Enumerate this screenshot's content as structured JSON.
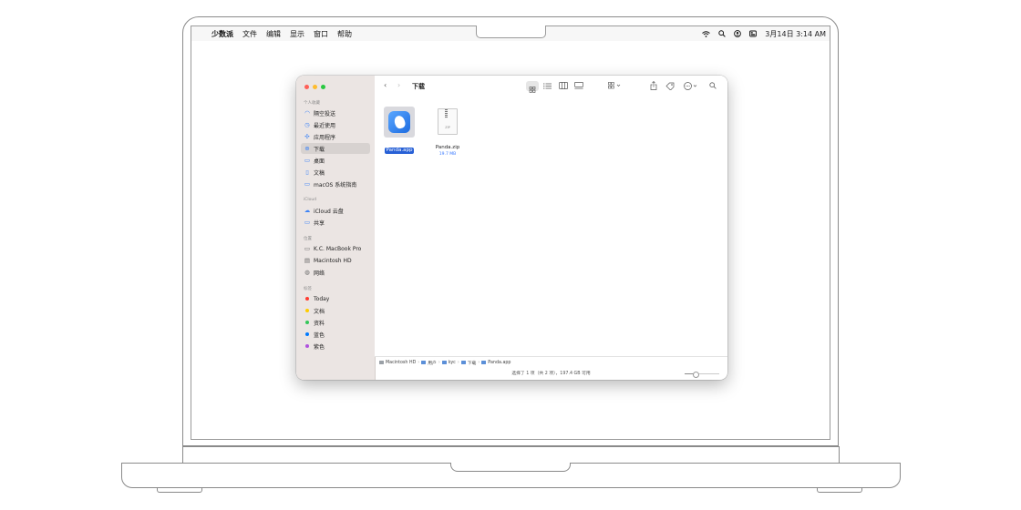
{
  "menubar": {
    "apple_glyph": "",
    "app_name": "少数派",
    "menus": [
      "文件",
      "编辑",
      "显示",
      "窗口",
      "帮助"
    ],
    "datetime": "3月14日  3:14 AM",
    "icons": [
      "wifi-icon",
      "search-icon",
      "user-icon",
      "control-center-icon"
    ]
  },
  "window": {
    "title": "下载",
    "colors": {
      "close": "#ff5f57",
      "minimize": "#febc2e",
      "zoom": "#28c840",
      "selection": "#2760d6"
    },
    "sidebar": {
      "sections": [
        {
          "heading": "个人收藏",
          "items": [
            {
              "label": "隔空投送",
              "icon": "airdrop-icon"
            },
            {
              "label": "最近使用",
              "icon": "clock-icon"
            },
            {
              "label": "应用程序",
              "icon": "apps-icon"
            },
            {
              "label": "下载",
              "icon": "download-icon",
              "selected": true
            },
            {
              "label": "桌面",
              "icon": "desktop-icon"
            },
            {
              "label": "文稿",
              "icon": "document-icon"
            },
            {
              "label": "macOS 系统指南",
              "icon": "folder-icon"
            }
          ]
        },
        {
          "heading": "iCloud",
          "items": [
            {
              "label": "iCloud 云盘",
              "icon": "cloud-icon"
            },
            {
              "label": "共享",
              "icon": "shared-folder-icon"
            }
          ]
        },
        {
          "heading": "位置",
          "items": [
            {
              "label": "K.C. MacBook Pro",
              "icon": "laptop-icon"
            },
            {
              "label": "Macintosh HD",
              "icon": "disk-icon"
            },
            {
              "label": "网络",
              "icon": "globe-icon"
            }
          ]
        },
        {
          "heading": "标签",
          "items": [
            {
              "label": "Today",
              "color": "#ff3b30"
            },
            {
              "label": "文档",
              "color": "#ffcc00"
            },
            {
              "label": "资料",
              "color": "#34c759"
            },
            {
              "label": "蓝色",
              "color": "#007aff"
            },
            {
              "label": "紫色",
              "color": "#af52de"
            }
          ]
        }
      ]
    },
    "files": [
      {
        "name": "Panda.app",
        "selected": true
      },
      {
        "name": "Panda.zip",
        "size": "19.7 MB",
        "icon_text": "ZIP"
      }
    ],
    "pathbar": [
      "Macintosh HD",
      "用户",
      "kyc",
      "下载",
      "Panda.app"
    ],
    "status": "选择了 1 项（共 2 项），197.4 GB 可用"
  }
}
